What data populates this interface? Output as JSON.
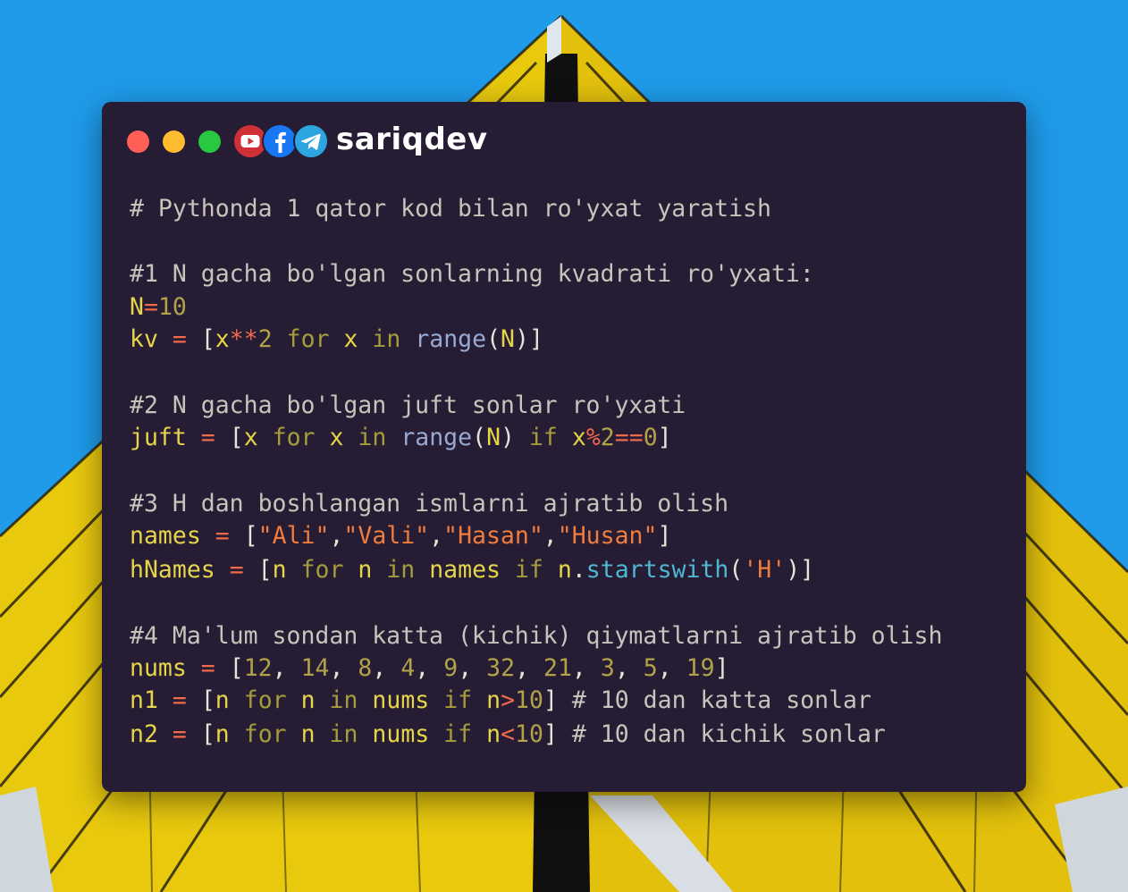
{
  "brand": {
    "name": "sariqdev",
    "icons": [
      "youtube-icon",
      "facebook-icon",
      "telegram-icon"
    ]
  },
  "window_controls": [
    "close",
    "minimize",
    "maximize"
  ],
  "colors": {
    "sky": "#1f9bea",
    "facade_yellow": "#e8c90e",
    "window_bg": "#261c33",
    "close": "#ff5f57",
    "minimize": "#febc2e",
    "maximize": "#28c840"
  },
  "code": {
    "title_comment": "# Pythonda 1 qator kod bilan ro'yxat yaratish",
    "s1": {
      "comment": "#1 N gacha bo'lgan sonlarning kvadrati ro'yxati:",
      "l1": {
        "v": "N",
        "op": "=",
        "n": "10"
      },
      "l2": {
        "v": "kv",
        "eq": "=",
        "ob": "[",
        "x1": "x",
        "pow": "**",
        "n2": "2",
        "kfor": "for",
        "x2": "x",
        "kin": "in",
        "range": "range",
        "p1": "(",
        "N": "N",
        "p2": ")",
        "cb": "]"
      }
    },
    "s2": {
      "comment": "#2 N gacha bo'lgan juft sonlar ro'yxati",
      "l1": {
        "v": "juft",
        "eq": "=",
        "ob": "[",
        "x1": "x",
        "kfor": "for",
        "x2": "x",
        "kin": "in",
        "range": "range",
        "p1": "(",
        "N": "N",
        "p2": ")",
        "kif": "if",
        "x3": "x",
        "mod": "%",
        "n2": "2",
        "eqeq": "==",
        "n0": "0",
        "cb": "]"
      }
    },
    "s3": {
      "comment": "#3 H dan boshlangan ismlarni ajratib olish",
      "l1": {
        "v": "names",
        "eq": "=",
        "ob": "[",
        "s1": "\"Ali\"",
        "c1": ",",
        "s2": "\"Vali\"",
        "c2": ",",
        "s3": "\"Hasan\"",
        "c3": ",",
        "s4": "\"Husan\"",
        "cb": "]"
      },
      "l2": {
        "v": "hNames",
        "eq": "=",
        "ob": "[",
        "n1": "n",
        "kfor": "for",
        "n2": "n",
        "kin": "in",
        "names": "names",
        "kif": "if",
        "n3": "n",
        "dot": ".",
        "method": "startswith",
        "p1": "(",
        "s": "'H'",
        "p2": ")",
        "cb": "]"
      }
    },
    "s4": {
      "comment": "#4 Ma'lum sondan katta (kichik) qiymatlarni ajratib olish",
      "l1": {
        "v": "nums",
        "eq": "=",
        "ob": "[",
        "values": [
          "12",
          "14",
          "8",
          "4",
          "9",
          "32",
          "21",
          "3",
          "5",
          "19"
        ],
        "sep": ",",
        "cb": "]"
      },
      "l2": {
        "v": "n1",
        "eq": "=",
        "ob": "[",
        "n1": "n",
        "kfor": "for",
        "n2": "n",
        "kin": "in",
        "nums": "nums",
        "kif": "if",
        "n3": "n",
        "cmp": ">",
        "num": "10",
        "cb": "]",
        "comment": "# 10 dan katta sonlar"
      },
      "l3": {
        "v": "n2",
        "eq": "=",
        "ob": "[",
        "n1": "n",
        "kfor": "for",
        "n2": "n",
        "kin": "in",
        "nums": "nums",
        "kif": "if",
        "n3": "n",
        "cmp": "<",
        "num": "10",
        "cb": "]",
        "comment": "# 10 dan kichik sonlar"
      }
    }
  }
}
